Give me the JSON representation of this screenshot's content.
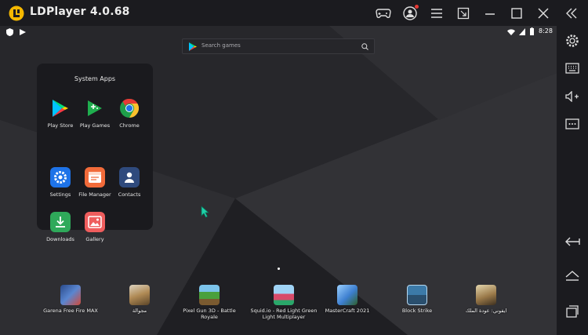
{
  "window": {
    "title": "LDPlayer 4.0.68"
  },
  "titlebar_icons": [
    "gamepad-icon",
    "account-icon",
    "menu-icon",
    "shrink-icon",
    "minimize-icon",
    "maximize-icon",
    "close-icon",
    "collapse-sidebar-icon"
  ],
  "statusbar": {
    "time": "8:28"
  },
  "search": {
    "placeholder": "Search games"
  },
  "folder": {
    "title": "System Apps",
    "apps": [
      {
        "label": "Play Store",
        "icon": "play-store-icon"
      },
      {
        "label": "Play Games",
        "icon": "play-games-icon"
      },
      {
        "label": "Chrome",
        "icon": "chrome-icon"
      },
      {
        "label": "Settings",
        "icon": "settings-icon"
      },
      {
        "label": "File Manager",
        "icon": "file-manager-icon"
      },
      {
        "label": "Contacts",
        "icon": "contacts-icon"
      },
      {
        "label": "Downloads",
        "icon": "downloads-icon"
      },
      {
        "label": "Gallery",
        "icon": "gallery-icon"
      }
    ]
  },
  "dock": [
    {
      "label": "Garena Free Fire MAX",
      "icon": "free-fire-icon",
      "color": "#3b5a9a"
    },
    {
      "label": "مجوالة",
      "icon": "game-icon",
      "color": "#b08a55"
    },
    {
      "label": "Pixel Gun 3D - Battle Royale",
      "icon": "pixel-gun-icon",
      "color": "#4aa03c"
    },
    {
      "label": "Squid.io - Red Light Green Light Multiplayer",
      "icon": "squid-io-icon",
      "color": "#d84b6a"
    },
    {
      "label": "MasterCraft 2021",
      "icon": "mastercraft-icon",
      "color": "#3d7fd0"
    },
    {
      "label": "Block Strike",
      "icon": "block-strike-icon",
      "color": "#3c7aa8"
    },
    {
      "label": "ايفوني: عودة الملك",
      "icon": "game-icon",
      "color": "#9b7a4a"
    }
  ],
  "sidebar_icons": [
    "settings-gear-icon",
    "keyboard-icon",
    "volume-up-icon",
    "more-icon",
    "back-icon",
    "home-icon",
    "recents-icon"
  ],
  "colors": {
    "accent": "#f5b800",
    "titlebar": "#1b1b1f",
    "notification_dot": "#e53935"
  }
}
